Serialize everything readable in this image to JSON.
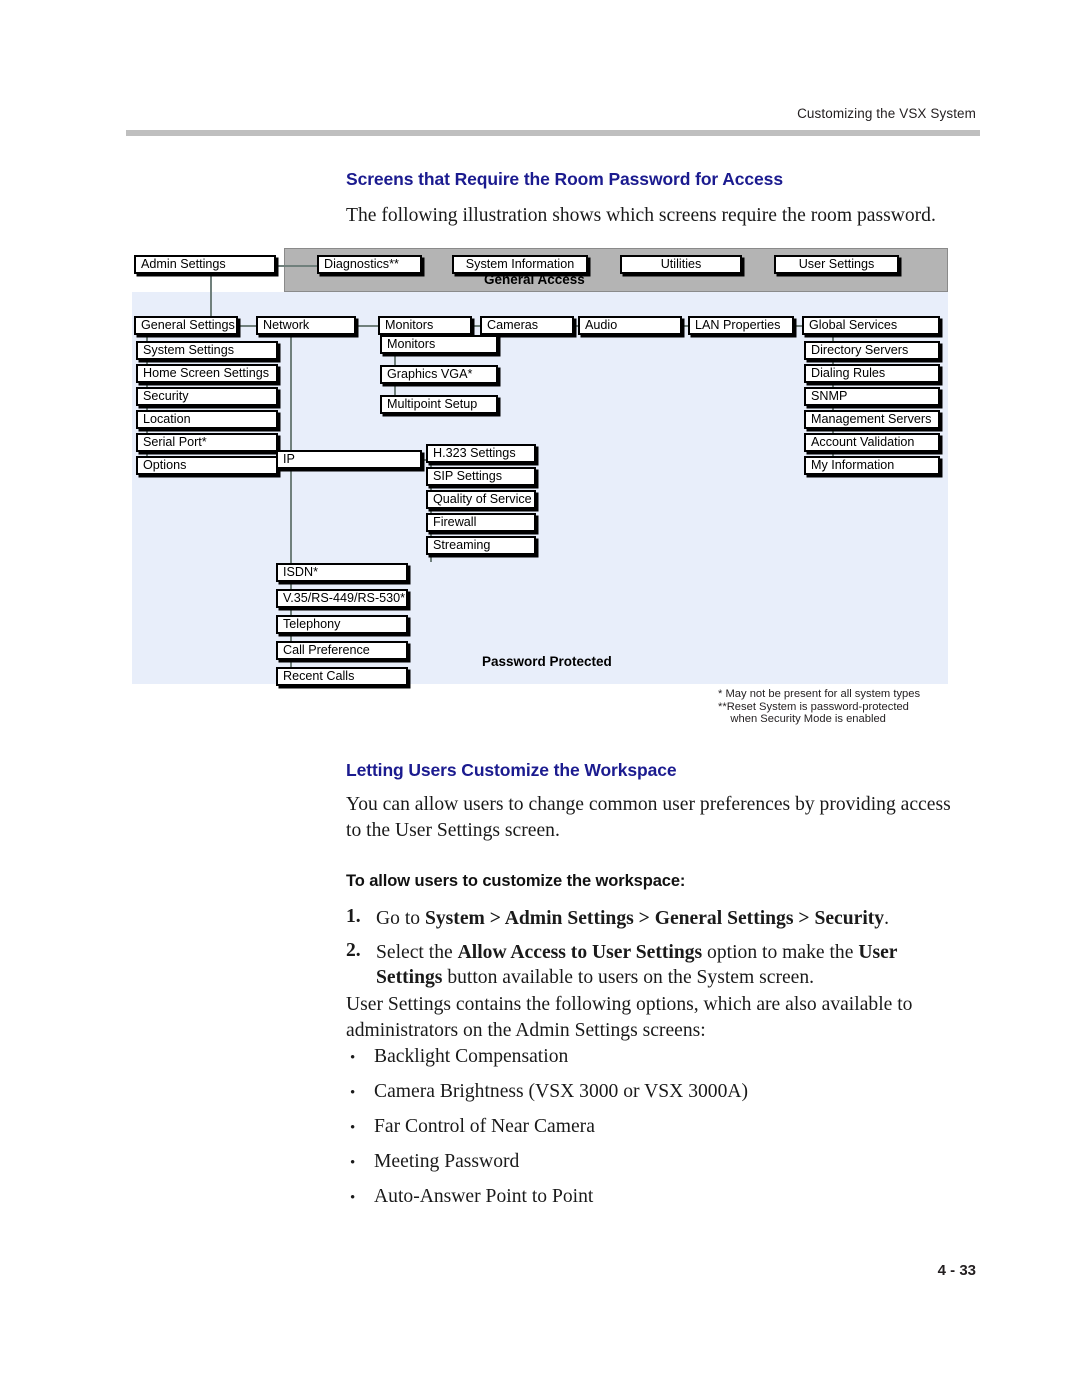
{
  "running_head": "Customizing the VSX System",
  "page_number": "4 - 33",
  "sections": {
    "heading_screens": "Screens that Require the Room Password for Access",
    "para_illustration": "The following illustration shows which screens require the room password.",
    "heading_letting": "Letting Users Customize the Workspace",
    "para_youcanallow": "You can allow users to change common user preferences by providing access to the User Settings screen.",
    "heading_toallow": "To allow users to customize the workspace:",
    "para_usersettings_contains": "User Settings contains the following options, which are also available to administrators on the Admin Settings screens:"
  },
  "steps": [
    {
      "num": "1.",
      "html": "Go to <b>System &gt; Admin Settings &gt; General Settings &gt; Security</b>."
    },
    {
      "num": "2.",
      "html": "Select the <b>Allow Access to User Settings</b> option to make the <b>User Settings</b> button available to users on the System screen."
    }
  ],
  "bullets": [
    {
      "dot": "•",
      "label": "Backlight Compensation"
    },
    {
      "dot": "•",
      "label": "Camera Brightness (VSX 3000 or VSX 3000A)"
    },
    {
      "dot": "•",
      "label": "Far Control of Near Camera"
    },
    {
      "dot": "•",
      "label": "Meeting Password"
    },
    {
      "dot": "•",
      "label": "Auto-Answer Point to Point"
    }
  ],
  "diagram": {
    "band_general_access": "General Access",
    "band_password_protected": "Password Protected",
    "footnotes": "* May not be present for all system types\n**Reset System is password-protected\n    when Security Mode is enabled",
    "colors": {
      "password_protected_bg": "#e8eefa",
      "general_access_bg": "#b4b4b4",
      "node_border": "#000000",
      "connector": "#70807c"
    },
    "nodes": {
      "admin_settings": "Admin Settings",
      "diagnostics": "Diagnostics**",
      "system_information": "System Information",
      "utilities": "Utilities",
      "user_settings": "User Settings",
      "general_settings": "General Settings",
      "network": "Network",
      "monitors_top": "Monitors",
      "cameras": "Cameras",
      "audio": "Audio",
      "lan_properties": "LAN Properties",
      "global_services": "Global Services",
      "system_settings": "System Settings",
      "home_screen_settings": "Home Screen Settings",
      "security": "Security",
      "location": "Location",
      "serial_port": "Serial Port*",
      "options": "Options",
      "monitors_sub": "Monitors",
      "graphics_vga": "Graphics VGA*",
      "multipoint_setup": "Multipoint Setup",
      "directory_servers": "Directory Servers",
      "dialing_rules": "Dialing Rules",
      "snmp": "SNMP",
      "management_servers": "Management Servers",
      "account_validation": "Account Validation",
      "my_information": "My Information",
      "ip": "IP",
      "h323_settings": "H.323 Settings",
      "sip_settings": "SIP Settings",
      "quality_of_service": "Quality of Service",
      "firewall": "Firewall",
      "streaming": "Streaming",
      "isdn": "ISDN*",
      "v35": "V.35/RS-449/RS-530*",
      "telephony": "Telephony",
      "call_preference": "Call Preference",
      "recent_calls": "Recent Calls"
    }
  }
}
